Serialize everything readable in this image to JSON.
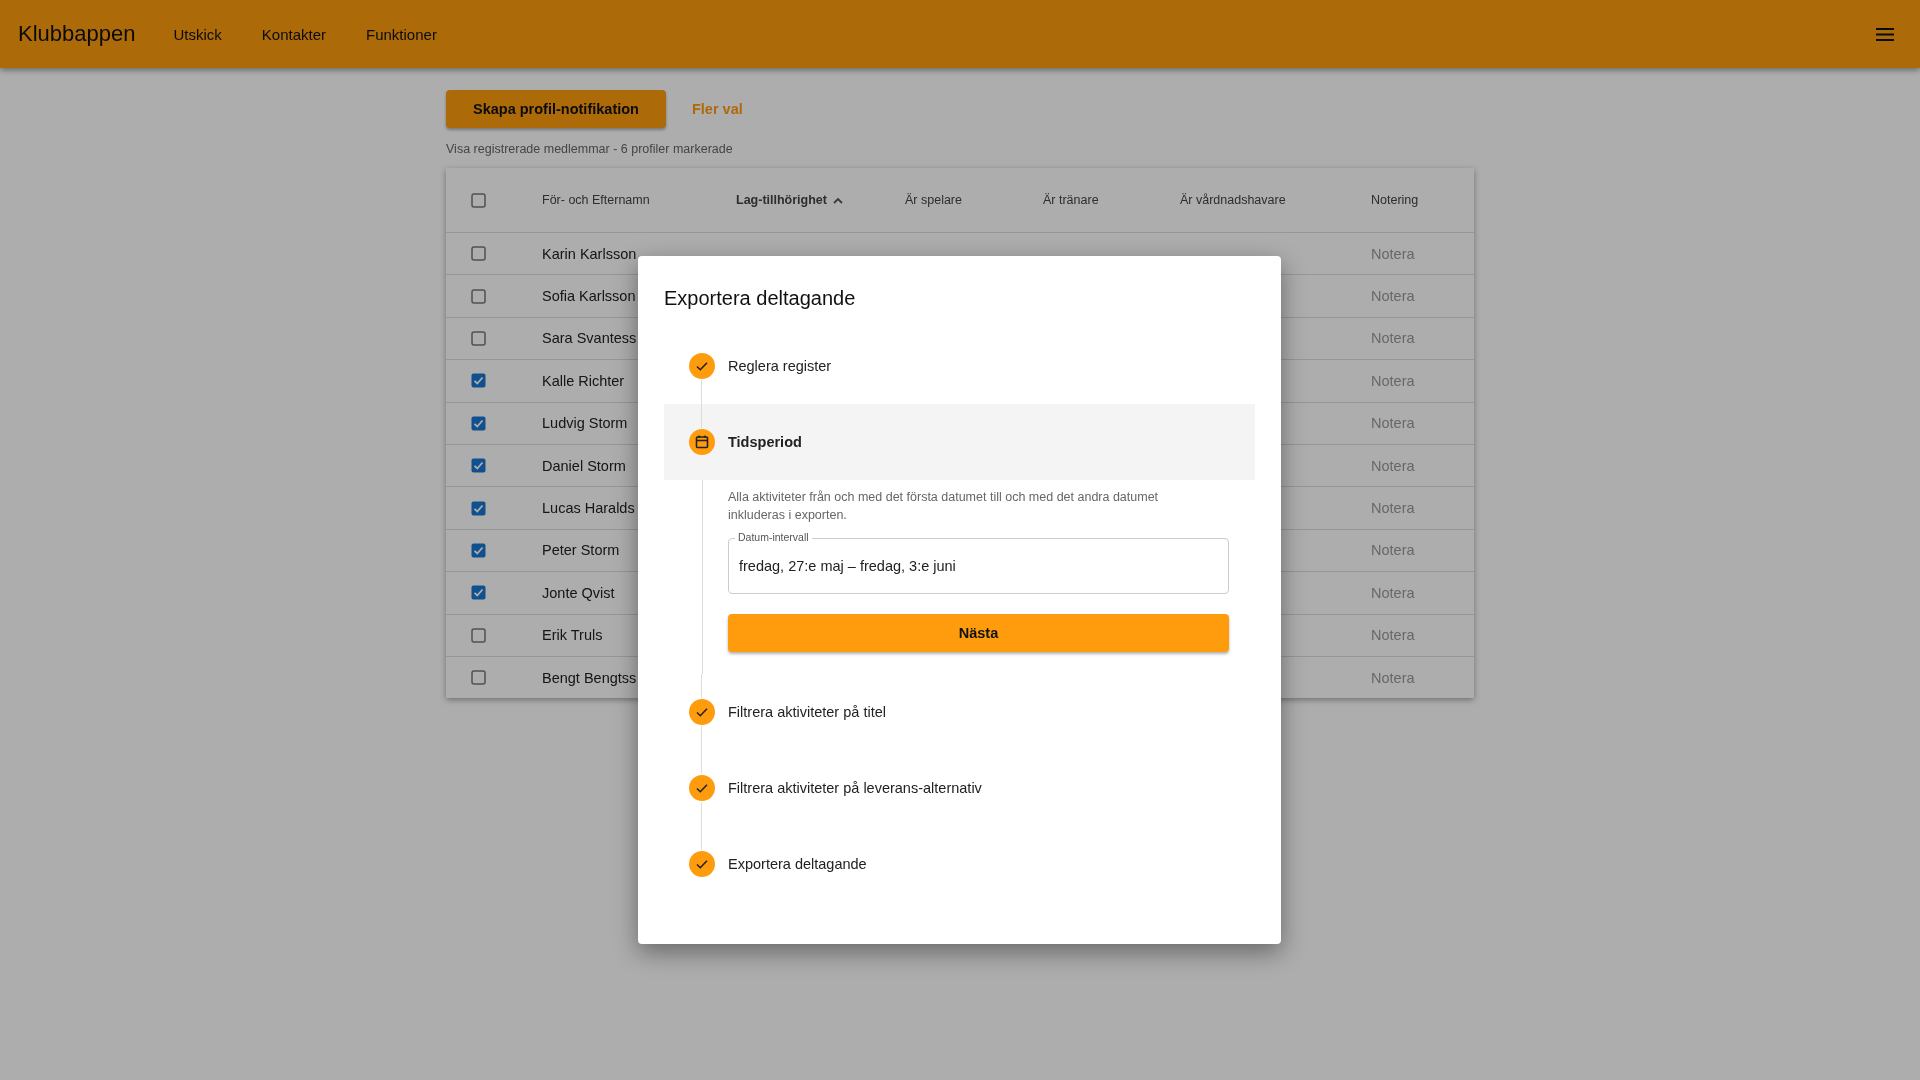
{
  "app_bar": {
    "title": "Klubbappen",
    "nav": [
      {
        "label": "Utskick"
      },
      {
        "label": "Kontakter"
      },
      {
        "label": "Funktioner"
      }
    ]
  },
  "actions": {
    "primary": "Skapa profil-notifikation",
    "secondary": "Fler val"
  },
  "summary": "Visa registrerade medlemmar - 6 profiler markerade",
  "table": {
    "header_checked": false,
    "columns": [
      {
        "label": "För- och Efternamn",
        "sorted": false
      },
      {
        "label": "Lag-tillhörighet",
        "sorted": true
      },
      {
        "label": "Är spelare",
        "sorted": false
      },
      {
        "label": "Är tränare",
        "sorted": false
      },
      {
        "label": "Är vårdnadshavare",
        "sorted": false
      },
      {
        "label": "Notering",
        "sorted": false
      }
    ],
    "rows": [
      {
        "checked": false,
        "cells": [
          "Karin Karlsson",
          "",
          "",
          "",
          "",
          "Notera"
        ]
      },
      {
        "checked": false,
        "cells": [
          "Sofia Karlsson",
          "",
          "",
          "",
          "",
          "Notera"
        ]
      },
      {
        "checked": false,
        "cells": [
          "Sara Svantess",
          "",
          "",
          "",
          "",
          "Notera"
        ]
      },
      {
        "checked": true,
        "cells": [
          "Kalle Richter",
          "",
          "",
          "",
          "",
          "Notera"
        ]
      },
      {
        "checked": true,
        "cells": [
          "Ludvig Storm",
          "",
          "",
          "",
          "",
          "Notera"
        ]
      },
      {
        "checked": true,
        "cells": [
          "Daniel Storm",
          "",
          "",
          "",
          "",
          "Notera"
        ]
      },
      {
        "checked": true,
        "cells": [
          "Lucas Haralds",
          "",
          "",
          "",
          "",
          "Notera"
        ]
      },
      {
        "checked": true,
        "cells": [
          "Peter Storm",
          "",
          "",
          "",
          "",
          "Notera"
        ]
      },
      {
        "checked": true,
        "cells": [
          "Jonte Qvist",
          "",
          "",
          "",
          "",
          "Notera"
        ]
      },
      {
        "checked": false,
        "cells": [
          "Erik Truls",
          "",
          "",
          "",
          "",
          "Notera"
        ]
      },
      {
        "checked": false,
        "cells": [
          "Bengt Bengtss",
          "",
          "",
          "",
          "",
          "Notera"
        ]
      }
    ]
  },
  "dialog": {
    "title": "Exportera deltagande",
    "steps": [
      {
        "label": "Reglera register",
        "selected": false,
        "done": true
      },
      {
        "label": "Tidsperiod",
        "selected": true,
        "done": false,
        "description": "Alla aktiviteter från och med det första datumet till och med det andra datumet inkluderas i exporten.",
        "field": {
          "label": "Datum-intervall",
          "value": "fredag, 27:e maj – fredag, 3:e juni"
        },
        "button": "Nästa"
      },
      {
        "label": "Filtrera aktiviteter på titel",
        "selected": false,
        "done": true
      },
      {
        "label": "Filtrera aktiviteter på leverans-alternativ",
        "selected": false,
        "done": true
      },
      {
        "label": "Exportera deltagande",
        "selected": false,
        "done": true
      }
    ]
  }
}
